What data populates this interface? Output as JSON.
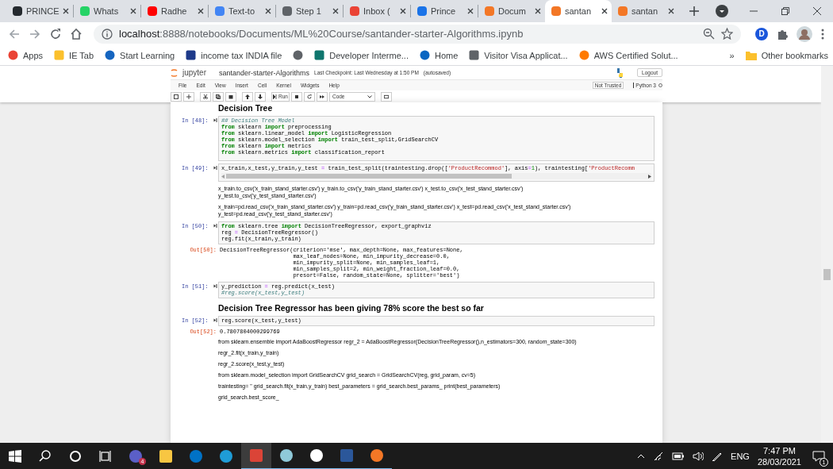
{
  "browser": {
    "tabs": [
      {
        "title": "PRINCE",
        "color": "#24292e",
        "selected": false
      },
      {
        "title": "Whats",
        "color": "#25d366",
        "selected": false
      },
      {
        "title": "Radhe",
        "color": "#ff0000",
        "selected": false
      },
      {
        "title": "Text-to",
        "color": "#4285f4",
        "selected": false
      },
      {
        "title": "Step 1",
        "color": "#5f6368",
        "selected": false
      },
      {
        "title": "Inbox (",
        "color": "#ea4335",
        "selected": false
      },
      {
        "title": "Prince",
        "color": "#1a73e8",
        "selected": false
      },
      {
        "title": "Docum",
        "color": "#f37726",
        "selected": false
      },
      {
        "title": "santan",
        "color": "#f37726",
        "selected": true
      },
      {
        "title": "santan",
        "color": "#f37726",
        "selected": false
      }
    ],
    "url_host": "localhost",
    "url_path": ":8888/notebooks/Documents/ML%20Course/santander-starter-Algorithms.ipynb",
    "extension_letter": "D",
    "bookmarks": [
      {
        "label": "Apps",
        "color": "#ea4335"
      },
      {
        "label": "IE Tab",
        "color": "#fbc02d"
      },
      {
        "label": "Start Learning",
        "color": "#1565c0"
      },
      {
        "label": "income tax INDIA file",
        "color": "#1e3a8a"
      },
      {
        "color": "#5f6368"
      },
      {
        "label": "Developer Interme...",
        "color": "#0f766e"
      },
      {
        "label": "Home",
        "color": "#0a66c2"
      },
      {
        "label": "Visitor Visa Applicat...",
        "color": "#5f6368"
      },
      {
        "label": "AWS Certified Solut...",
        "color": "#ff7a00"
      }
    ],
    "bookmarks_overflow": "»",
    "other_bookmarks": "Other bookmarks"
  },
  "notebook": {
    "logo": "jupyter",
    "name": "santander-starter-Algorithms",
    "checkpoint": "Last Checkpoint: Last Wednesday at 1:50 PM",
    "autosave": "(autosaved)",
    "logout": "Logout",
    "menu": [
      "File",
      "Edit",
      "View",
      "Insert",
      "Cell",
      "Kernel",
      "Widgets",
      "Help"
    ],
    "trusted": "Not Trusted",
    "kernel": "Python 3",
    "run": "Run",
    "cell_type": "Code",
    "cells": [
      {
        "kind": "heading",
        "text": "Decision Tree"
      },
      {
        "kind": "code",
        "prompt": "In [48]:",
        "lines": [
          [
            {
              "kind": "comment",
              "text": "## Decision Tree Model"
            }
          ],
          [
            {
              "kind": "keyword",
              "text": "from"
            },
            {
              "kind": "plain",
              "text": " sklearn "
            },
            {
              "kind": "keyword",
              "text": "import"
            },
            {
              "kind": "plain",
              "text": " preprocessing"
            }
          ],
          [
            {
              "kind": "keyword",
              "text": "from"
            },
            {
              "kind": "plain",
              "text": " sklearn.linear_model "
            },
            {
              "kind": "keyword",
              "text": "import"
            },
            {
              "kind": "plain",
              "text": " LogisticRegression"
            }
          ],
          [
            {
              "kind": "keyword",
              "text": "from"
            },
            {
              "kind": "plain",
              "text": " sklearn.model_selection "
            },
            {
              "kind": "keyword",
              "text": "import"
            },
            {
              "kind": "plain",
              "text": " train_test_split,GridSearchCV"
            }
          ],
          [
            {
              "kind": "keyword",
              "text": "from"
            },
            {
              "kind": "plain",
              "text": " sklearn "
            },
            {
              "kind": "keyword",
              "text": "import"
            },
            {
              "kind": "plain",
              "text": " metrics"
            }
          ],
          [
            {
              "kind": "keyword",
              "text": "from"
            },
            {
              "kind": "plain",
              "text": " sklearn.metrics "
            },
            {
              "kind": "keyword",
              "text": "import"
            },
            {
              "kind": "plain",
              "text": " classification_report"
            }
          ]
        ]
      },
      {
        "kind": "code",
        "prompt": "In [49]:",
        "scroll": true,
        "lines": [
          [
            {
              "kind": "plain",
              "text": "x_train,x_test,y_train,y_test "
            },
            {
              "kind": "operator",
              "text": "="
            },
            {
              "kind": "plain",
              "text": " train_test_split(traintesting.drop(["
            },
            {
              "kind": "string",
              "text": "'ProductRecommod'"
            },
            {
              "kind": "plain",
              "text": "], axis"
            },
            {
              "kind": "operator",
              "text": "="
            },
            {
              "kind": "number",
              "text": "1"
            },
            {
              "kind": "plain",
              "text": "), traintesting["
            },
            {
              "kind": "string",
              "text": "'ProductRecomm"
            }
          ]
        ]
      },
      {
        "kind": "markdown",
        "lines": [
          "x_train.to_csv('x_train_stand_starter.csv') y_train.to_csv('y_train_stand_starter.csv') x_test.to_csv('x_test_stand_starter.csv')",
          "y_test.to_csv('y_test_stand_starter.csv')"
        ]
      },
      {
        "kind": "markdown",
        "lines": [
          "x_train=pd.read_csv('x_train_stand_starter.csv') y_train=pd.read_csv('y_train_stand_starter.csv') x_test=pd.read_csv('x_test_stand_starter.csv')",
          "y_test=pd.read_csv('y_test_stand_starter.csv')"
        ]
      },
      {
        "kind": "code",
        "prompt": "In [50]:",
        "lines": [
          [
            {
              "kind": "keyword",
              "text": "from"
            },
            {
              "kind": "plain",
              "text": " sklearn.tree "
            },
            {
              "kind": "keyword",
              "text": "import"
            },
            {
              "kind": "plain",
              "text": " DecisionTreeRegressor, export_graphviz"
            }
          ],
          [
            {
              "kind": "plain",
              "text": "reg "
            },
            {
              "kind": "operator",
              "text": "="
            },
            {
              "kind": "plain",
              "text": " DecisionTreeRegressor()"
            }
          ],
          [
            {
              "kind": "plain",
              "text": "reg.fit(x_train,y_train)"
            }
          ]
        ]
      },
      {
        "kind": "output",
        "prompt": "Out[50]:",
        "lines": [
          "DecisionTreeRegressor(criterion='mse', max_depth=None, max_features=None,",
          "                      max_leaf_nodes=None, min_impurity_decrease=0.0,",
          "                      min_impurity_split=None, min_samples_leaf=1,",
          "                      min_samples_split=2, min_weight_fraction_leaf=0.0,",
          "                      presort=False, random_state=None, splitter='best')"
        ]
      },
      {
        "kind": "code",
        "prompt": "In [51]:",
        "lines": [
          [
            {
              "kind": "plain",
              "text": "y_prediction "
            },
            {
              "kind": "operator",
              "text": "="
            },
            {
              "kind": "plain",
              "text": " reg.predict(x_test)"
            }
          ],
          [
            {
              "kind": "comment",
              "text": "#reg.score(x_test,y_test)"
            }
          ]
        ]
      },
      {
        "kind": "heading",
        "text": "Decision Tree Regressor has been giving 78% score the best so far"
      },
      {
        "kind": "code",
        "prompt": "In [52]:",
        "lines": [
          [
            {
              "kind": "plain",
              "text": "reg.score(x_test,y_test)"
            }
          ]
        ]
      },
      {
        "kind": "output",
        "prompt": "Out[52]:",
        "lines": [
          "0.7807804000299769"
        ]
      },
      {
        "kind": "markdown",
        "lines": [
          "from sklearn.ensemble import AdaBoostRegressor regr_2 = AdaBoostRegressor(DecisionTreeRegressor(),n_estimators=300, random_state=300)"
        ]
      },
      {
        "kind": "markdown",
        "lines": [
          "regr_2.fit(x_train,y_train)"
        ]
      },
      {
        "kind": "markdown",
        "lines": [
          "regr_2.score(x_test,y_test)"
        ]
      },
      {
        "kind": "markdown",
        "lines": [
          "from sklearn.model_selection import GridSearchCV grid_search = GridSearchCV(reg, grid_param, cv=5)"
        ]
      },
      {
        "kind": "markdown",
        "lines": [
          "traintesting= \" grid_search.fit(x_train,y_train) best_parameters = grid_search.best_params_ print(best_parameters)"
        ]
      },
      {
        "kind": "markdown",
        "lines": [
          "grid_search.best_score_"
        ]
      }
    ]
  },
  "taskbar": {
    "apps": [
      {
        "color": "#5b5fc7",
        "running": false,
        "selected": false,
        "badge": "4"
      },
      {
        "color": "#f8c642",
        "running": false,
        "selected": false
      },
      {
        "color": "#0072c6",
        "running": false,
        "selected": false
      },
      {
        "color": "#1f9cd6",
        "running": false,
        "selected": false
      },
      {
        "color": "#db4437",
        "running": true,
        "selected": true
      },
      {
        "color": "#8fc9d9",
        "running": true,
        "selected": false
      },
      {
        "color": "#ffffff",
        "running": true,
        "selected": false
      },
      {
        "color": "#2b579a",
        "running": true,
        "selected": false
      },
      {
        "color": "#f37726",
        "running": true,
        "selected": false
      }
    ],
    "language": "ENG",
    "time": "7:47 PM",
    "date": "28/03/2021",
    "notifications": "1"
  }
}
